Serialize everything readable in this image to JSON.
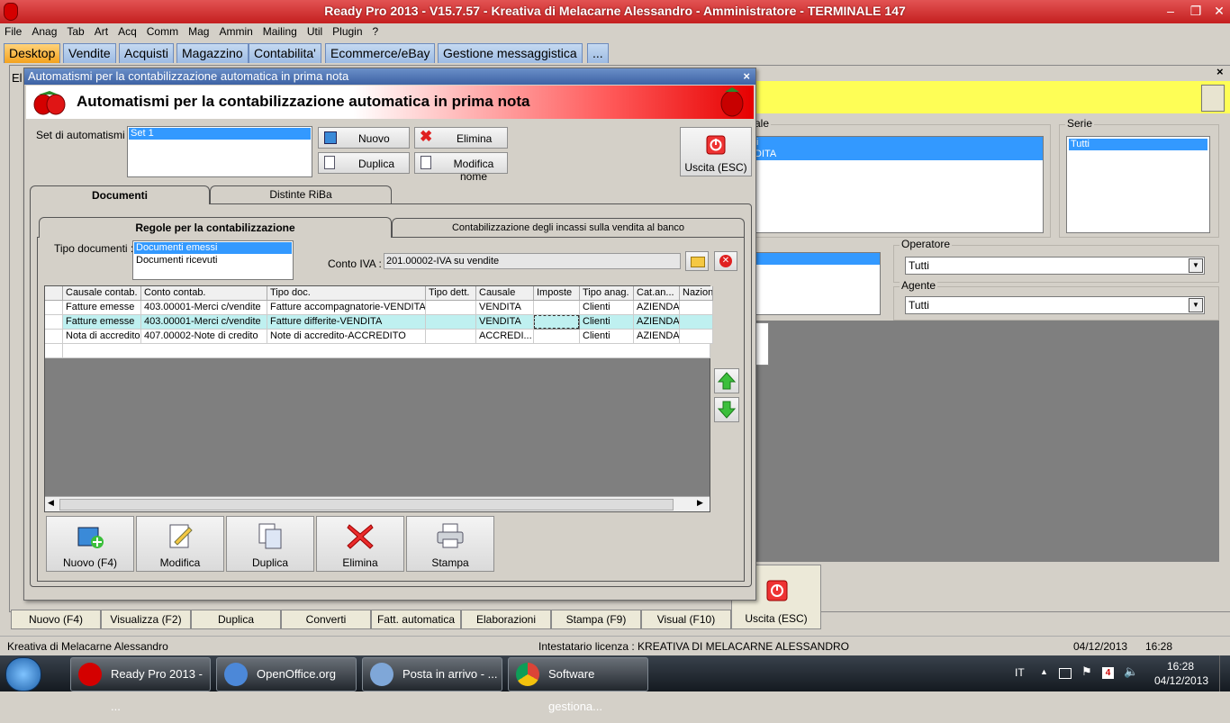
{
  "app": {
    "title": "Ready Pro 2013 - V15.7.57 - Kreativa di Melacarne Alessandro - Amministratore - TERMINALE 147"
  },
  "menu": [
    "File",
    "Anag",
    "Tab",
    "Art",
    "Acq",
    "Comm",
    "Mag",
    "Ammin",
    "Mailing",
    "Util",
    "Plugin",
    "?"
  ],
  "main_tabs": [
    "Desktop",
    "Vendite",
    "Acquisti",
    "Magazzino",
    "Contabilita'",
    "Ecommerce/eBay",
    "Gestione messaggistica",
    "..."
  ],
  "background": {
    "left_fragment": "El",
    "causale_label": "ale",
    "causale_items": [
      "i",
      "DITA"
    ],
    "serie_label": "Serie",
    "serie_items": [
      "Tutti"
    ],
    "operatore_label": "Operatore",
    "operatore_value": "Tutti",
    "agente_label": "Agente",
    "agente_value": "Tutti",
    "exit_label": "Uscita (ESC)",
    "bottom_buttons": [
      "Nuovo (F4)",
      "Visualizza (F2)",
      "Duplica",
      "Converti",
      "Fatt. automatica",
      "Elaborazioni",
      "Stampa (F9)",
      "Visual (F10)"
    ]
  },
  "dialog": {
    "title": "Automatismi per la contabilizzazione automatica in prima nota",
    "header": "Automatismi per la contabilizzazione automatica in prima nota",
    "set_label": "Set di automatismi :",
    "set_items": [
      "Set 1"
    ],
    "buttons": {
      "nuovo": "Nuovo",
      "elimina": "Elimina",
      "duplica": "Duplica",
      "modifica_nome": "Modifica nome",
      "uscita": "Uscita (ESC)"
    },
    "tabs": [
      "Documenti",
      "Distinte RiBa"
    ],
    "subtabs": [
      "Regole per la contabilizzazione",
      "Contabilizzazione degli incassi sulla vendita al banco"
    ],
    "tipo_documenti_label": "Tipo documenti :",
    "tipo_documenti": [
      "Documenti emessi",
      "Documenti ricevuti"
    ],
    "conto_iva_label": "Conto IVA :",
    "conto_iva_value": "201.00002-IVA su vendite",
    "grid": {
      "columns": [
        "Causale contab.",
        "Conto contab.",
        "Tipo doc.",
        "Tipo dett.",
        "Causale",
        "Imposte",
        "Tipo anag.",
        "Cat.an...",
        "Nazion"
      ],
      "rows": [
        [
          "Fatture emesse",
          "403.00001-Merci c/vendite",
          "Fatture accompagnatorie-VENDITA",
          "",
          "VENDITA",
          "",
          "Clienti",
          "AZIENDA",
          ""
        ],
        [
          "Fatture emesse",
          "403.00001-Merci c/vendite",
          "Fatture differite-VENDITA",
          "",
          "VENDITA",
          "",
          "Clienti",
          "AZIENDA",
          ""
        ],
        [
          "Nota di accredito",
          "407.00002-Note di credito",
          "Note di accredito-ACCREDITO",
          "",
          "ACCREDI...",
          "",
          "Clienti",
          "AZIENDA",
          ""
        ]
      ]
    },
    "bottom_buttons": [
      "Nuovo (F4)",
      "Modifica",
      "Duplica",
      "Elimina",
      "Stampa"
    ]
  },
  "statusbar": {
    "company": "Kreativa di Melacarne Alessandro",
    "license": "Intestatario licenza : KREATIVA DI MELACARNE ALESSANDRO",
    "date": "04/12/2013",
    "time": "16:28"
  },
  "taskbar": {
    "items": [
      "Ready Pro 2013 - ...",
      "OpenOffice.org",
      "Posta in arrivo - ...",
      "Software gestiona..."
    ],
    "lang": "IT",
    "clock_time": "16:28",
    "clock_date": "04/12/2013",
    "notif_count": "4"
  }
}
